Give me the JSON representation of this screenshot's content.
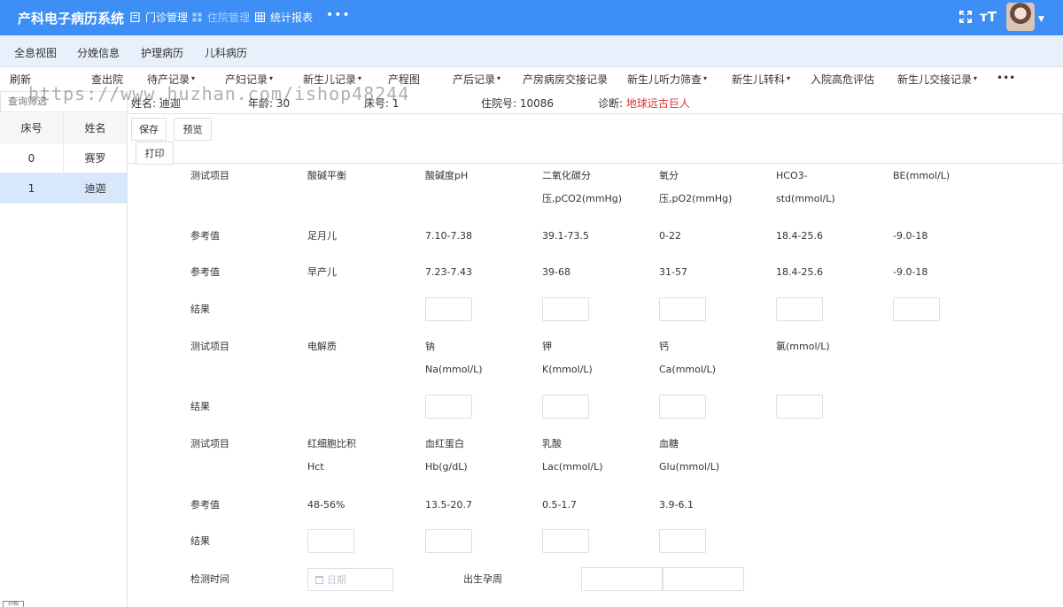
{
  "app": {
    "title": "产科电子病历系统"
  },
  "topnav": {
    "items": [
      {
        "label": "门诊管理",
        "icon": "document-icon"
      },
      {
        "label": "住院管理",
        "icon": "grid-icon"
      },
      {
        "label": "统计报表",
        "icon": "table-icon"
      }
    ],
    "more": "•••",
    "font_size_icon": "тT"
  },
  "tabs": [
    "全息视图",
    "分娩信息",
    "护理病历",
    "儿科病历"
  ],
  "toolbar": {
    "items": [
      "刷新",
      "查出院",
      "待产记录",
      "产妇记录",
      "新生儿记录",
      "产程图",
      "产后记录",
      "产房病房交接记录",
      "新生儿听力筛查",
      "新生儿转科",
      "入院高危评估",
      "新生儿交接记录"
    ],
    "more": "•••"
  },
  "watermark": "https://www.huzhan.com/ishop48244",
  "search": {
    "placeholder": "查询筛选"
  },
  "patient": {
    "name_label": "姓名:",
    "name": "迪迦",
    "age_label": "年龄:",
    "age": "30",
    "bed_label": "床号:",
    "bed": "1",
    "inpatient_label": "住院号:",
    "inpatient_no": "10086",
    "diagnosis_label": "诊断:",
    "diagnosis": "地球远古巨人"
  },
  "bed_list": {
    "headers": [
      "床号",
      "姓名"
    ],
    "rows": [
      {
        "bed": "0",
        "name": "赛罗"
      },
      {
        "bed": "1",
        "name": "迪迦"
      }
    ],
    "selected_index": 1
  },
  "sidebar_footer_tag": "开始",
  "actions": {
    "save": "保存",
    "preview": "预览",
    "print": "打印"
  },
  "form": {
    "acid_base": {
      "header": [
        "测试项目",
        "酸碱平衡",
        "酸碱度pH",
        "二氧化碳分",
        "氧分",
        "HCO3-",
        "BE(mmol/L)"
      ],
      "header_line2": [
        "",
        "",
        "",
        "压,pCO2(mmHg)",
        "压,pO2(mmHg)",
        "std(mmol/L)",
        ""
      ],
      "ref_fullterm": [
        "参考值",
        "足月儿",
        "7.10-7.38",
        "39.1-73.5",
        "0-22",
        "18.4-25.6",
        "-9.0-18"
      ],
      "ref_preterm": [
        "参考值",
        "早产儿",
        "7.23-7.43",
        "39-68",
        "31-57",
        "18.4-25.6",
        "-9.0-18"
      ],
      "result_label": "结果"
    },
    "electrolyte": {
      "header": [
        "测试项目",
        "电解质",
        "钠",
        "钾",
        "钙",
        "氯(mmol/L)"
      ],
      "header_line2": [
        "",
        "",
        "Na(mmol/L)",
        "K(mmol/L)",
        "Ca(mmol/L)",
        ""
      ],
      "result_label": "结果"
    },
    "blood": {
      "header": [
        "测试项目",
        "红细胞比积",
        "血红蛋白",
        "乳酸",
        "血糖"
      ],
      "header_line2": [
        "",
        "Hct",
        "Hb(g/dL)",
        "Lac(mmol/L)",
        "Glu(mmol/L)"
      ],
      "ref": [
        "参考值",
        "48-56%",
        "13.5-20.7",
        "0.5-1.7",
        "3.9-6.1"
      ],
      "result_label": "结果"
    },
    "detect_time_label": "检测时间",
    "date_placeholder": "日期",
    "gestation_label": "出生孕周"
  },
  "colors": {
    "primary": "#3d8ef5",
    "tabs_bg": "#e8f0fb",
    "selected_row": "#d7e7fc",
    "diagnosis": "#e0312b"
  }
}
